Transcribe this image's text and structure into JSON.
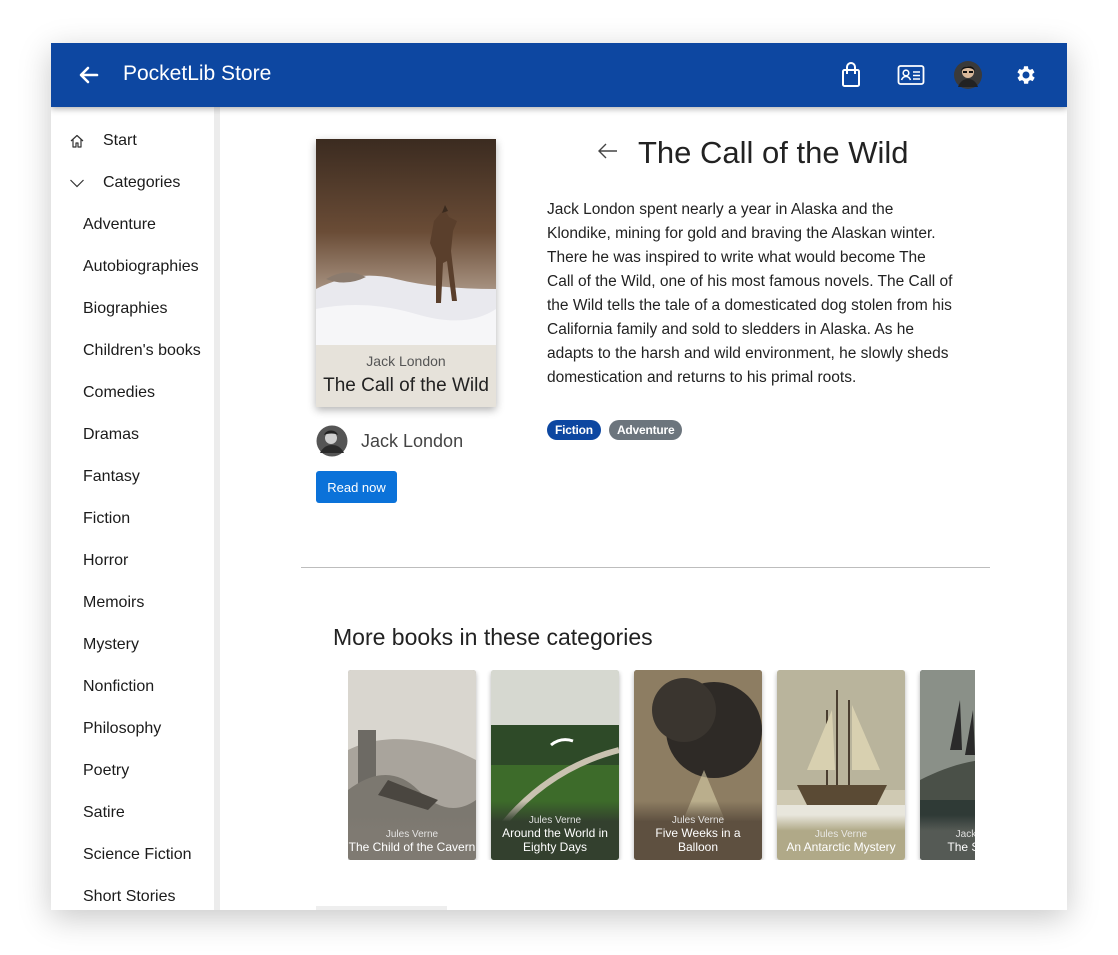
{
  "app": {
    "title": "PocketLib Store"
  },
  "toolbar": {
    "icons": [
      "back-arrow-icon",
      "shopping-bag-icon",
      "contact-card-icon",
      "avatar",
      "gear-icon"
    ]
  },
  "sidebar": {
    "start_label": "Start",
    "categories_label": "Categories",
    "items": [
      {
        "label": "Adventure"
      },
      {
        "label": "Autobiographies"
      },
      {
        "label": "Biographies"
      },
      {
        "label": "Children's books"
      },
      {
        "label": "Comedies"
      },
      {
        "label": "Dramas"
      },
      {
        "label": "Fantasy"
      },
      {
        "label": "Fiction"
      },
      {
        "label": "Horror"
      },
      {
        "label": "Memoirs"
      },
      {
        "label": "Mystery"
      },
      {
        "label": "Nonfiction"
      },
      {
        "label": "Philosophy"
      },
      {
        "label": "Poetry"
      },
      {
        "label": "Satire"
      },
      {
        "label": "Science Fiction"
      },
      {
        "label": "Short Stories"
      }
    ]
  },
  "book": {
    "author": "Jack London",
    "title": "The Call of the Wild",
    "description": "Jack London spent nearly a year in Alaska and the Klondike, mining for gold and braving the Alaskan winter. There he was inspired to write what would become The Call of the Wild, one of his most famous novels. The Call of the Wild tells the tale of a domesticated dog stolen from his California family and sold to sledders in Alaska. As he adapts to the harsh and wild environment, he slowly sheds domestication and returns to his primal roots.",
    "tags": [
      {
        "label": "Fiction",
        "color": "#0d47a1"
      },
      {
        "label": "Adventure",
        "color": "#6c757d"
      }
    ],
    "read_label": "Read now"
  },
  "more": {
    "title": "More books in these categories",
    "books": [
      {
        "author": "Jules Verne",
        "title": "The Child of the Cavern"
      },
      {
        "author": "Jules Verne",
        "title": "Around the World in Eighty Days"
      },
      {
        "author": "Jules Verne",
        "title": "Five Weeks in a Balloon"
      },
      {
        "author": "Jules Verne",
        "title": "An Antarctic Mystery"
      },
      {
        "author": "Jack London",
        "title": "The Sea-Wolf"
      }
    ]
  },
  "colors": {
    "appbar": "#0d47a1",
    "read_button": "#0b72d9"
  }
}
